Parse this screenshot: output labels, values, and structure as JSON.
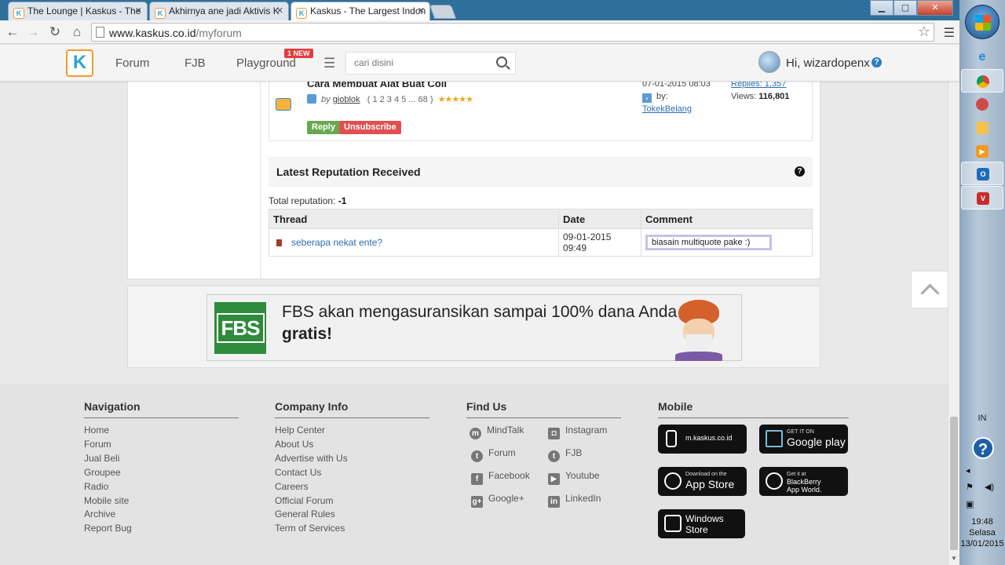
{
  "browser": {
    "tabs": [
      {
        "title": "The Lounge | Kaskus - The"
      },
      {
        "title": "Akhirnya ane jadi Aktivis K"
      },
      {
        "title": "Kaskus - The Largest Indon"
      }
    ],
    "url_host": "www.kaskus.co.id",
    "url_path": "/myforum",
    "window_buttons": {
      "minimize": "▁",
      "maximize": "▢",
      "close": "✕"
    }
  },
  "header": {
    "logo": "K",
    "nav": [
      {
        "label": "Forum"
      },
      {
        "label": "FJB"
      },
      {
        "label": "Playground",
        "badge": "1 NEW"
      }
    ],
    "search": {
      "placeholder": "cari disini"
    },
    "user_greeting": "Hi, wizardopenx",
    "help": "?"
  },
  "subscribed_thread": {
    "title": "Cara Membuat Alat Buat Coli",
    "by_prefix": "by",
    "author": "gioblok",
    "pages": "( 1  2  3  4  5 ... 68 )",
    "rating": "★★★★★",
    "last_post_date": "07-01-2015 08:03",
    "last_by_label": "by:",
    "last_by_user": "TokekBelang",
    "replies_label": "Replies: 1,357",
    "views_label": "Views:",
    "views_value": "116,801",
    "reply_button": "Reply",
    "unsubscribe_button": "Unsubscribe"
  },
  "reputation": {
    "heading": "Latest Reputation Received",
    "help": "?",
    "total_label": "Total reputation:",
    "total_value": "-1",
    "columns": [
      "Thread",
      "Date",
      "Comment"
    ],
    "rows": [
      {
        "thread": "seberapa nekat ente?",
        "date": "09-01-2015 09:49",
        "comment": "biasain multiquote pake :)"
      }
    ]
  },
  "ad": {
    "brand": "FBS",
    "line1": "FBS akan mengasuransikan sampai 100% dana Anda",
    "line2": "gratis!"
  },
  "footer": {
    "navigation": {
      "title": "Navigation",
      "links": [
        "Home",
        "Forum",
        "Jual Beli",
        "Groupee",
        "Radio",
        "Mobile site",
        "Archive",
        "Report Bug"
      ]
    },
    "company": {
      "title": "Company Info",
      "links": [
        "Help Center",
        "About Us",
        "Advertise with Us",
        "Contact Us",
        "Careers",
        "Official Forum",
        "General Rules",
        "Term of Services"
      ]
    },
    "find_us": {
      "title": "Find Us",
      "items": [
        {
          "label": "MindTalk",
          "icon": "mindtalk-icon"
        },
        {
          "label": "Instagram",
          "icon": "instagram-icon"
        },
        {
          "label": "Forum",
          "icon": "twitter-icon"
        },
        {
          "label": "FJB",
          "icon": "twitter-icon"
        },
        {
          "label": "Facebook",
          "icon": "facebook-icon"
        },
        {
          "label": "Youtube",
          "icon": "youtube-icon"
        },
        {
          "label": "Google+",
          "icon": "googleplus-icon"
        },
        {
          "label": "LinkedIn",
          "icon": "linkedin-icon"
        }
      ]
    },
    "mobile": {
      "title": "Mobile",
      "stores": [
        {
          "small": "",
          "big": "m.kaskus.co.id"
        },
        {
          "small": "GET IT ON",
          "big": "Google play"
        },
        {
          "small": "Download on the",
          "big": "App Store"
        },
        {
          "small": "Get it at",
          "big": "BlackBerry App World."
        },
        {
          "small": "",
          "big": "Windows Store"
        }
      ]
    }
  },
  "taskbar": {
    "language": "IN",
    "help": "?",
    "time": "19:48",
    "day": "Selasa",
    "date": "13/01/2015"
  }
}
